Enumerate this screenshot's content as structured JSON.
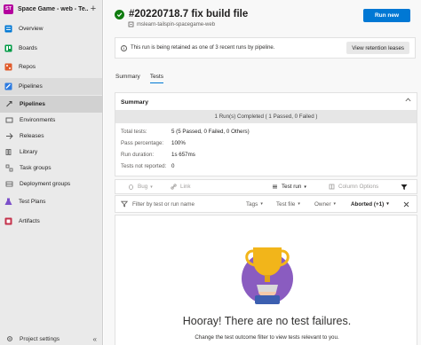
{
  "project": {
    "avatar": "ST",
    "name": "Space Game - web - Te...",
    "add": "+"
  },
  "nav": [
    {
      "label": "Overview",
      "icon": "overview-icon"
    },
    {
      "label": "Boards",
      "icon": "boards-icon"
    },
    {
      "label": "Repos",
      "icon": "repos-icon"
    },
    {
      "label": "Pipelines",
      "icon": "pipelines-icon"
    },
    {
      "label": "Pipelines",
      "icon": "pipelines-sub-icon"
    },
    {
      "label": "Environments",
      "icon": "environments-icon"
    },
    {
      "label": "Releases",
      "icon": "releases-icon"
    },
    {
      "label": "Library",
      "icon": "library-icon"
    },
    {
      "label": "Task groups",
      "icon": "task-groups-icon"
    },
    {
      "label": "Deployment groups",
      "icon": "deployment-groups-icon"
    },
    {
      "label": "Test Plans",
      "icon": "test-plans-icon"
    },
    {
      "label": "Artifacts",
      "icon": "artifacts-icon"
    }
  ],
  "footer": {
    "settings_label": "Project settings",
    "collapse": "«"
  },
  "run": {
    "title": "#20220718.7 fix build file",
    "repo": "mslearn-tailspin-spacegame-web",
    "run_new_label": "Run new"
  },
  "banner": {
    "info": "i",
    "text": "This run is being retained as one of 3 recent runs by pipeline.",
    "button_label": "View retention leases"
  },
  "tabs": [
    "Summary",
    "Tests"
  ],
  "summary": {
    "title": "Summary",
    "completed": "1 Run(s) Completed ( 1 Passed, 0 Failed )",
    "stats": [
      {
        "label": "Total tests:",
        "value": "5 (5 Passed, 0 Failed, 0 Others)"
      },
      {
        "label": "Pass percentage:",
        "value": "100%"
      },
      {
        "label": "Run duration:",
        "value": "1s 657ms"
      },
      {
        "label": "Tests not reported:",
        "value": "0"
      }
    ]
  },
  "toolbar": {
    "bug": "Bug",
    "link": "Link",
    "test_run": "Test run",
    "column_options": "Column Options"
  },
  "filter": {
    "placeholder": "Filter by test or run name",
    "tags": "Tags",
    "test_file": "Test file",
    "owner": "Owner",
    "outcome": "Aborted (+1)"
  },
  "empty_state": {
    "title": "Hooray! There are no test failures.",
    "subtitle": "Change the test outcome filter to view tests relevant to you."
  },
  "colors": {
    "accent": "#0078d4",
    "success": "#107c10",
    "project": "#b4009e",
    "trophy_bg": "#8a5cc0",
    "trophy": "#f2b51a"
  }
}
